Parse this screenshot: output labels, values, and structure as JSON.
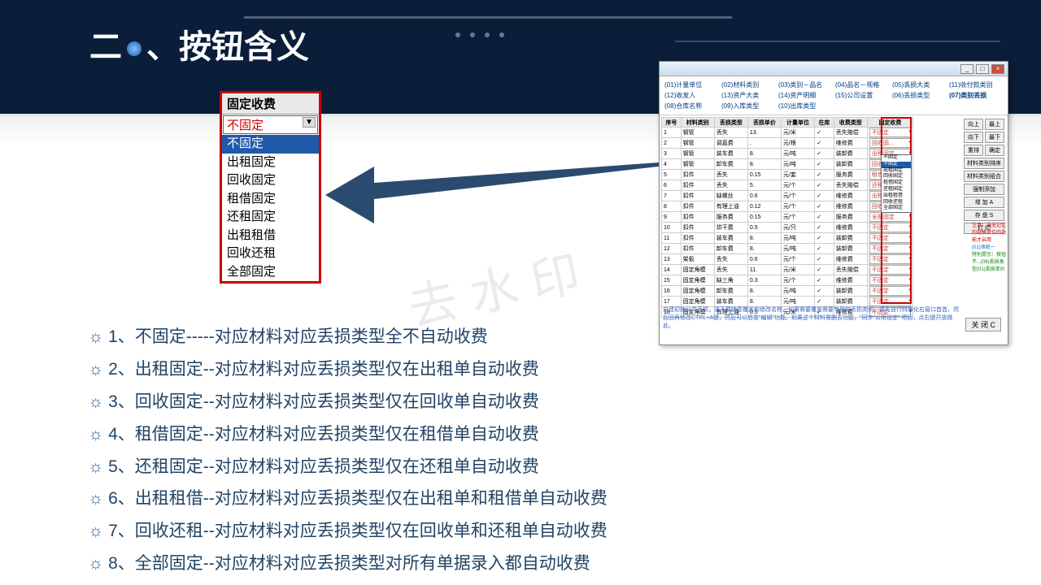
{
  "title_prefix": "二",
  "title_main": "按钮含义",
  "dropdown": {
    "header": "固定收费",
    "selected": "不固定",
    "options": [
      "不固定",
      "出租固定",
      "回收固定",
      "租借固定",
      "还租固定",
      "出租租借",
      "回收还租",
      "全部固定"
    ]
  },
  "bullets": [
    "1、不固定-----对应材料对应丢损类型全不自动收费",
    "2、出租固定--对应材料对应丢损类型仅在出租单自动收费",
    "3、回收固定--对应材料对应丢损类型仅在回收单自动收费",
    "4、租借固定--对应材料对应丢损类型仅在租借单自动收费",
    "5、还租固定--对应材料对应丢损类型仅在还租单自动收费",
    "6、出租租借--对应材料对应丢损类型仅在出租单和租借单自动收费",
    "7、回收还租--对应材料对应丢损类型仅在回收单和还租单自动收费",
    "8、全部固定--对应材料对应丢损类型对所有单据录入都自动收费"
  ],
  "tags": [
    "(01)计量单位",
    "(02)材料类别",
    "(03)类别－品名",
    "(04)品名－规格",
    "(05)丢损大类",
    "(11)收付款类别",
    "(12)收发人",
    "(13)资产大类",
    "(14)资产明细",
    "(15)公司设置",
    "(06)丢损类型",
    "(07)类别丢损",
    "(08)仓库名称",
    "(09)入库类型",
    "(10)出库类型"
  ],
  "hl_tag_index": 11,
  "cols": [
    "序号",
    "材料类别",
    "丢损类型",
    "丢损单价",
    "计量单位",
    "在库",
    "收费类型",
    "固定收费"
  ],
  "rows": [
    [
      "1",
      "钢管",
      "丢失",
      "13.",
      "元/米",
      "✓",
      "丢失赔偿",
      "不固定"
    ],
    [
      "2",
      "钢管",
      "调直费",
      ".",
      "元/根",
      "✓",
      "维修费",
      "回收固..."
    ],
    [
      "3",
      "钢管",
      "装车费",
      "8.",
      "元/吨",
      "✓",
      "装卸费",
      "出租固定"
    ],
    [
      "4",
      "钢管",
      "卸车费",
      "8.",
      "元/吨",
      "✓",
      "装卸费",
      "回收固定"
    ],
    [
      "5",
      "扣件",
      "丢失",
      "0.15",
      "元/套",
      "✓",
      "服务费",
      "租借固定"
    ],
    [
      "6",
      "扣件",
      "丢失",
      "5.",
      "元/个",
      "✓",
      "丢失赔偿",
      "还租固定"
    ],
    [
      "7",
      "扣件",
      "缺螺丝",
      "0.6",
      "元/个",
      "✓",
      "维修费",
      "出租租借"
    ],
    [
      "8",
      "扣件",
      "有理上油",
      "0.12",
      "元/个",
      "✓",
      "维修费",
      "回收还租"
    ],
    [
      "9",
      "扣件",
      "服务费",
      "0.15",
      "元/个",
      "✓",
      "服务费",
      "全部固定"
    ],
    [
      "10",
      "扣件",
      "烘干费",
      "0.5",
      "元/只",
      "✓",
      "维修费",
      "不固定"
    ],
    [
      "11",
      "扣件",
      "装车费",
      "8.",
      "元/吨",
      "✓",
      "装卸费",
      "不固定"
    ],
    [
      "12",
      "扣件",
      "卸车费",
      "8.",
      "元/吨",
      "✓",
      "装卸费",
      "不固定"
    ],
    [
      "13",
      "架板",
      "丢失",
      "0.6",
      "元/个",
      "✓",
      "维修费",
      "不固定"
    ],
    [
      "14",
      "固定角模",
      "丢失",
      "11.",
      "元/米",
      "✓",
      "丢失赔偿",
      "不固定"
    ],
    [
      "15",
      "固定角模",
      "缺三角",
      "0.3",
      "元/个",
      "✓",
      "维修费",
      "不固定"
    ],
    [
      "16",
      "固定角模",
      "卸车费",
      "8.",
      "元/吨",
      "✓",
      "装卸费",
      "不固定"
    ],
    [
      "17",
      "固定角模",
      "装车费",
      "8.",
      "元/吨",
      "✓",
      "装卸费",
      "不固定"
    ],
    [
      "18",
      "固定角模",
      "有理上油",
      "0.5",
      "元/米",
      "✓",
      "维修费",
      "不固定"
    ]
  ],
  "side_buttons": [
    "向上",
    "最上",
    "向下",
    "最下",
    "重排",
    "确定",
    "材料类别排序",
    "材料类别组合",
    "增 加 A",
    "存 盘 S",
    "打 印",
    "强制添加"
  ],
  "close_label": "关 闭 C",
  "foot": "自建初始公共丢损，请不要随意覆盖和修改名称。如果需要覆盖需要专用的丢损类别，请先自行特殊化右窗口首首，然后回再修改CTRL+A键，然后可以启变\"编辑\"功能。如果这个材料需删去功能，\"同步\"公用设定\" 项后，点右键开放做此。"
}
